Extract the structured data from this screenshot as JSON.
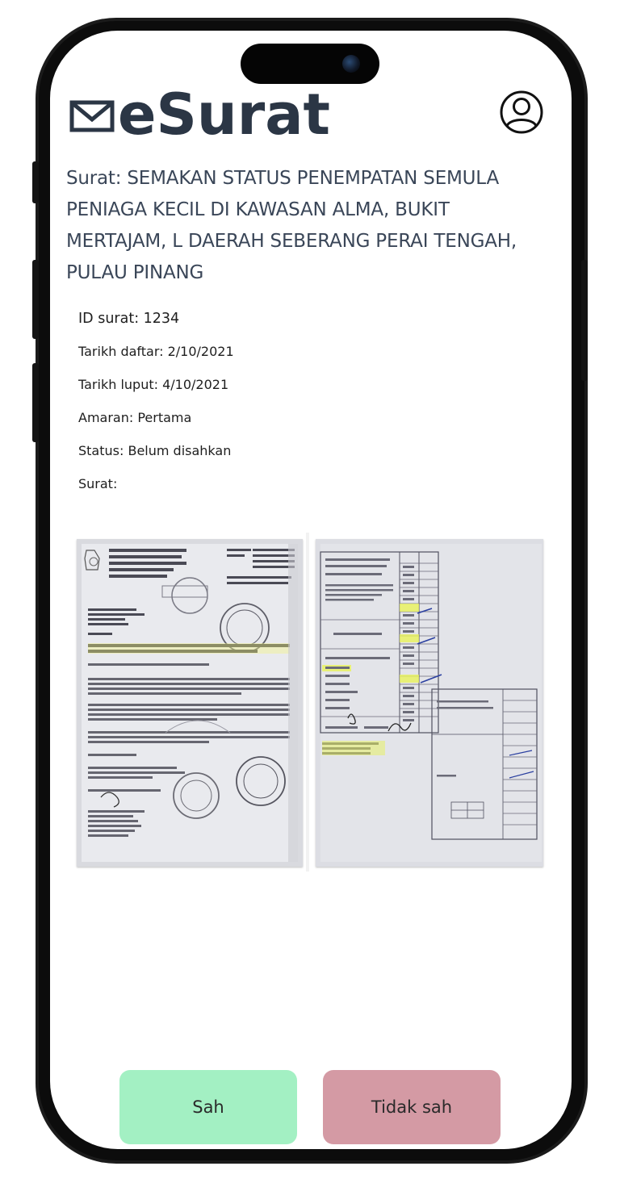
{
  "app": {
    "name": "eSurat"
  },
  "letter": {
    "title": "Surat:  SEMAKAN STATUS PENEMPATAN SEMULA PENIAGA KECIL DI KAWASAN ALMA, BUKIT MERTAJAM, L DAERAH SEBERANG PERAI TENGAH, PULAU PINANG",
    "id_line": "ID surat: 1234",
    "registered_line": "Tarikh daftar: 2/10/2021",
    "expiry_line": "Tarikh luput: 4/10/2021",
    "warning_line": "Amaran: Pertama",
    "status_line": "Status: Belum disahkan",
    "attachment_label": "Surat:"
  },
  "actions": {
    "approve_label": "Sah",
    "reject_label": "Tidak sah"
  },
  "colors": {
    "approve": "#a3f0c3",
    "reject": "#d49aa4",
    "title_text": "#2b3645"
  },
  "icons": {
    "logo": "envelope-icon",
    "profile": "user-profile-icon"
  }
}
